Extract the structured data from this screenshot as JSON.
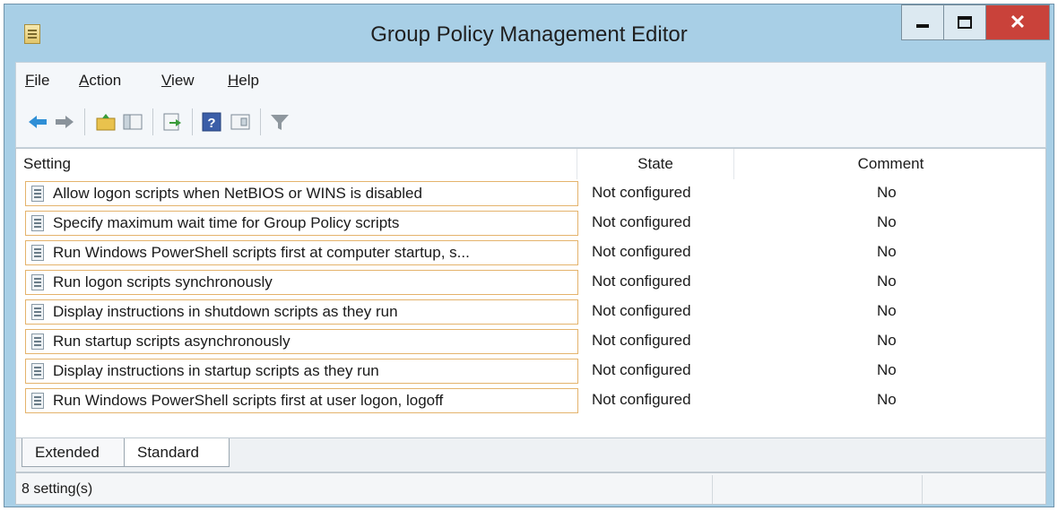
{
  "window": {
    "title": "Group Policy Management Editor"
  },
  "menu": {
    "file": {
      "mnemonic": "F",
      "rest": "ile"
    },
    "action": {
      "mnemonic": "A",
      "rest": "ction"
    },
    "view": {
      "mnemonic": "V",
      "rest": "iew"
    },
    "help": {
      "mnemonic": "H",
      "rest": "elp"
    }
  },
  "toolbar": {
    "icons": [
      "back-icon",
      "forward-icon",
      "up-folder-icon",
      "show-hide-tree-icon",
      "export-list-icon",
      "help-icon",
      "properties-icon",
      "filter-icon"
    ]
  },
  "columns": {
    "setting": "Setting",
    "state": "State",
    "comment": "Comment"
  },
  "rows": [
    {
      "setting": "Allow logon scripts when NetBIOS or WINS is disabled",
      "state": "Not configured",
      "comment": "No"
    },
    {
      "setting": "Specify maximum wait time for Group Policy scripts",
      "state": "Not configured",
      "comment": "No"
    },
    {
      "setting": "Run Windows PowerShell scripts first at computer startup, s...",
      "state": "Not configured",
      "comment": "No"
    },
    {
      "setting": "Run logon scripts synchronously",
      "state": "Not configured",
      "comment": "No"
    },
    {
      "setting": "Display instructions in shutdown scripts as they run",
      "state": "Not configured",
      "comment": "No"
    },
    {
      "setting": "Run startup scripts asynchronously",
      "state": "Not configured",
      "comment": "No"
    },
    {
      "setting": "Display instructions in startup scripts as they run",
      "state": "Not configured",
      "comment": "No"
    },
    {
      "setting": "Run Windows PowerShell scripts first at user logon, logoff",
      "state": "Not configured",
      "comment": "No"
    }
  ],
  "tabs": {
    "extended": "Extended",
    "standard": "Standard",
    "selected": "Standard"
  },
  "status": {
    "text": "8 setting(s)"
  },
  "colors": {
    "frame": "#a8cfe6",
    "close": "#c9423a",
    "row_border": "#e4b36c"
  }
}
